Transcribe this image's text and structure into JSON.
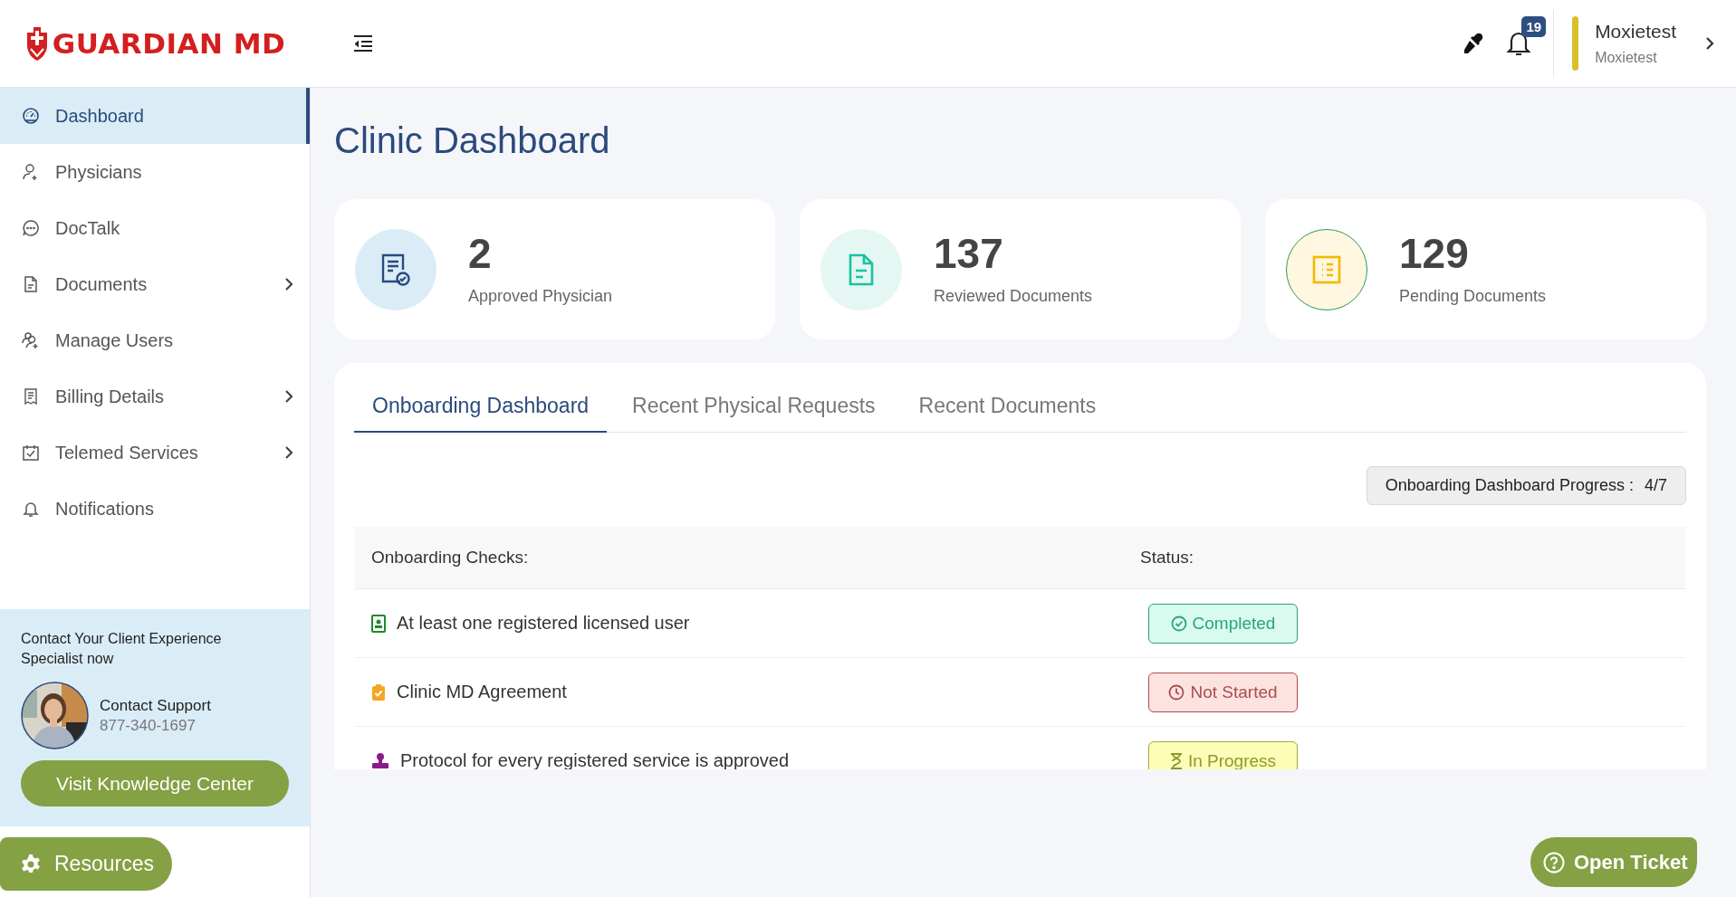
{
  "header": {
    "logo": "GUARDIAN MD",
    "notification_count": "19",
    "user": {
      "name": "Moxietest",
      "subtitle": "Moxietest"
    }
  },
  "sidebar": {
    "items": [
      {
        "label": "Dashboard",
        "selected": true,
        "expandable": false
      },
      {
        "label": "Physicians",
        "selected": false,
        "expandable": false
      },
      {
        "label": "DocTalk",
        "selected": false,
        "expandable": false
      },
      {
        "label": "Documents",
        "selected": false,
        "expandable": true
      },
      {
        "label": "Manage Users",
        "selected": false,
        "expandable": false
      },
      {
        "label": "Billing Details",
        "selected": false,
        "expandable": true
      },
      {
        "label": "Telemed Services",
        "selected": false,
        "expandable": true
      },
      {
        "label": "Notifications",
        "selected": false,
        "expandable": false
      }
    ],
    "contact": {
      "prompt": "Contact Your Client Experience Specialist now",
      "title": "Contact Support",
      "phone": "877-340-1697",
      "button": "Visit Knowledge Center"
    },
    "resources_button": "Resources"
  },
  "main": {
    "title": "Clinic Dashboard",
    "stats": [
      {
        "value": "2",
        "label": "Approved Physician"
      },
      {
        "value": "137",
        "label": "Reviewed Documents"
      },
      {
        "value": "129",
        "label": "Pending Documents"
      }
    ],
    "tabs": [
      {
        "label": "Onboarding Dashboard",
        "selected": true
      },
      {
        "label": "Recent Physical Requests",
        "selected": false
      },
      {
        "label": "Recent Documents",
        "selected": false
      }
    ],
    "progress": {
      "label": "Onboarding Dashboard Progress :",
      "value": "4/7"
    },
    "table": {
      "columns": [
        "Onboarding Checks:",
        "Status:"
      ],
      "rows": [
        {
          "check": "At least one registered licensed user",
          "status": "Completed",
          "kind": "completed"
        },
        {
          "check": "Clinic MD Agreement",
          "status": "Not Started",
          "kind": "not_started"
        },
        {
          "check": "Protocol for every registered service is approved",
          "status": "In Progress",
          "kind": "in_progress"
        }
      ]
    }
  },
  "open_ticket_button": "Open Ticket"
}
